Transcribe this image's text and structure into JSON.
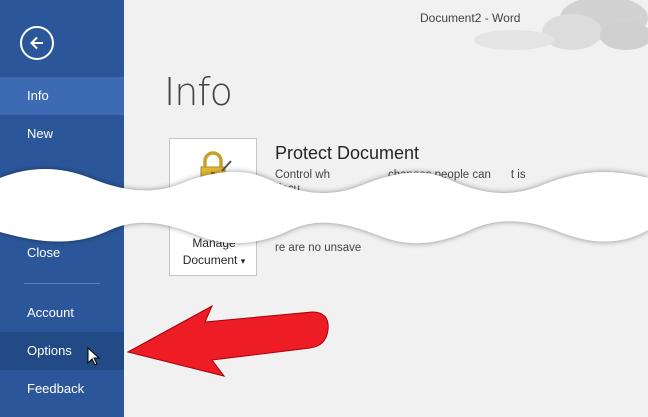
{
  "window": {
    "title": "Document2 - Word"
  },
  "sidebar": {
    "back_icon": "back-arrow-icon",
    "items": [
      {
        "label": "Info"
      },
      {
        "label": "New"
      },
      {
        "label": "Close"
      },
      {
        "label": "Account"
      },
      {
        "label": "Options"
      },
      {
        "label": "Feedback"
      }
    ],
    "colors": {
      "background": "#2b579a",
      "selected": "#3d6bb3"
    }
  },
  "main": {
    "page_title": "Info",
    "protect": {
      "tile_label_line1": "Manage",
      "tile_label_line2": "Document",
      "dropdown_glyph": "▾",
      "icon": "lock-icon",
      "title": "Protect Document",
      "description_line1_start": "Control wh",
      "description_line1_end": "changes people can",
      "description_line1_tail": "t is",
      "description_line2": "docu",
      "status_text": "re are no unsave"
    }
  },
  "annotation": {
    "arrow_color": "#ee1c25",
    "pointing_to": "Options"
  }
}
